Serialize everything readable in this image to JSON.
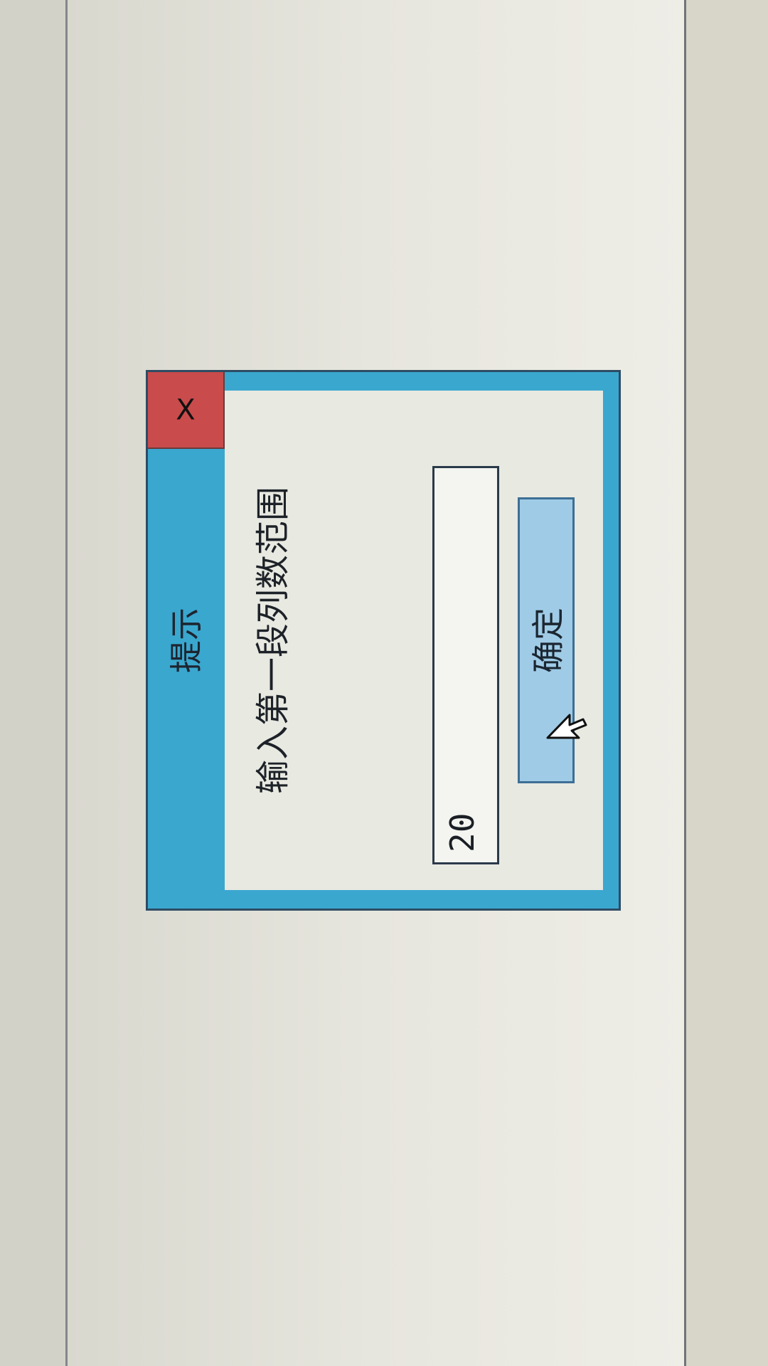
{
  "dialog": {
    "title": "提示",
    "close_label": "X",
    "prompt": "输入第一段列数范围",
    "input_value": "20",
    "ok_label": "确定"
  },
  "icons": {
    "close": "close-icon",
    "cursor": "mouse-cursor-icon"
  },
  "colors": {
    "dialog_frame": "#3aa7cf",
    "close_button": "#c94b4b",
    "ok_button": "#9fcbe6",
    "client_area": "#e8e9e1"
  }
}
